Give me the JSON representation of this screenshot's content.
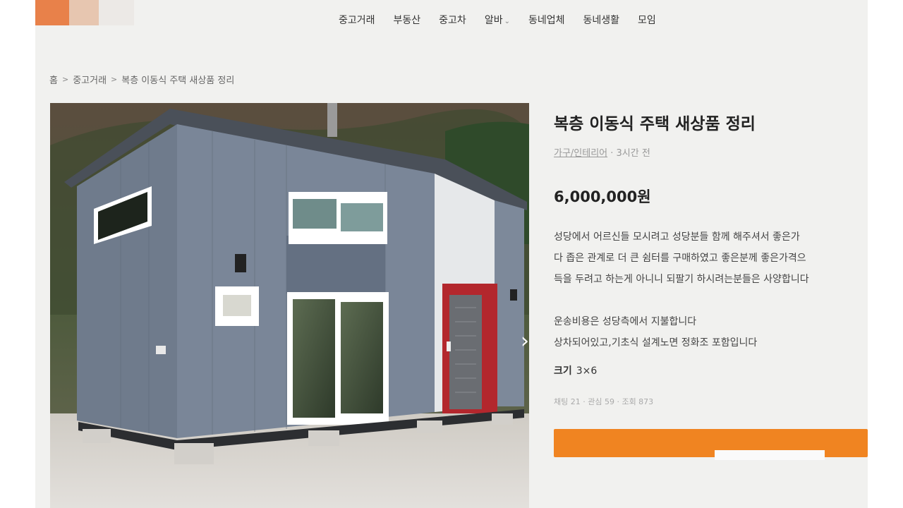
{
  "nav": {
    "items": [
      {
        "label": "중고거래"
      },
      {
        "label": "부동산"
      },
      {
        "label": "중고차"
      },
      {
        "label": "알바",
        "has_dropdown": true
      },
      {
        "label": "동네업체"
      },
      {
        "label": "동네생활"
      },
      {
        "label": "모임"
      }
    ]
  },
  "breadcrumb": {
    "items": [
      "홈",
      "중고거래",
      "복층 이동식 주택 새상품 정리"
    ]
  },
  "product": {
    "title": "복층 이동식 주택 새상품 정리",
    "category": "가구/인테리어",
    "posted": " · 3시간 전",
    "price": "6,000,000원",
    "description_lines": [
      "성당에서 어르신들 모시려고 성당분들 함께 해주셔서 좋은가",
      "다 좁은 관계로 더 큰 쉼터를 구매하였고 좋은분께 좋은가격으",
      "득을 두려고 하는게 아니니 되팔기 하시려는분들은 사양합니다"
    ],
    "description_lines_2": [
      "운송비용은 성당측에서 지불합니다",
      "상차되어있고,기초식 설계노면 정화조 포함입니다"
    ],
    "size_label": "크기",
    "size_value": "3×6",
    "stats": "채팅 21 · 관심 59 · 조회 873"
  },
  "colors": {
    "accent": "#f08421",
    "logo_orange": "#e8814a",
    "door_red": "#b3272d",
    "house_siding": "#6d7a8c"
  }
}
